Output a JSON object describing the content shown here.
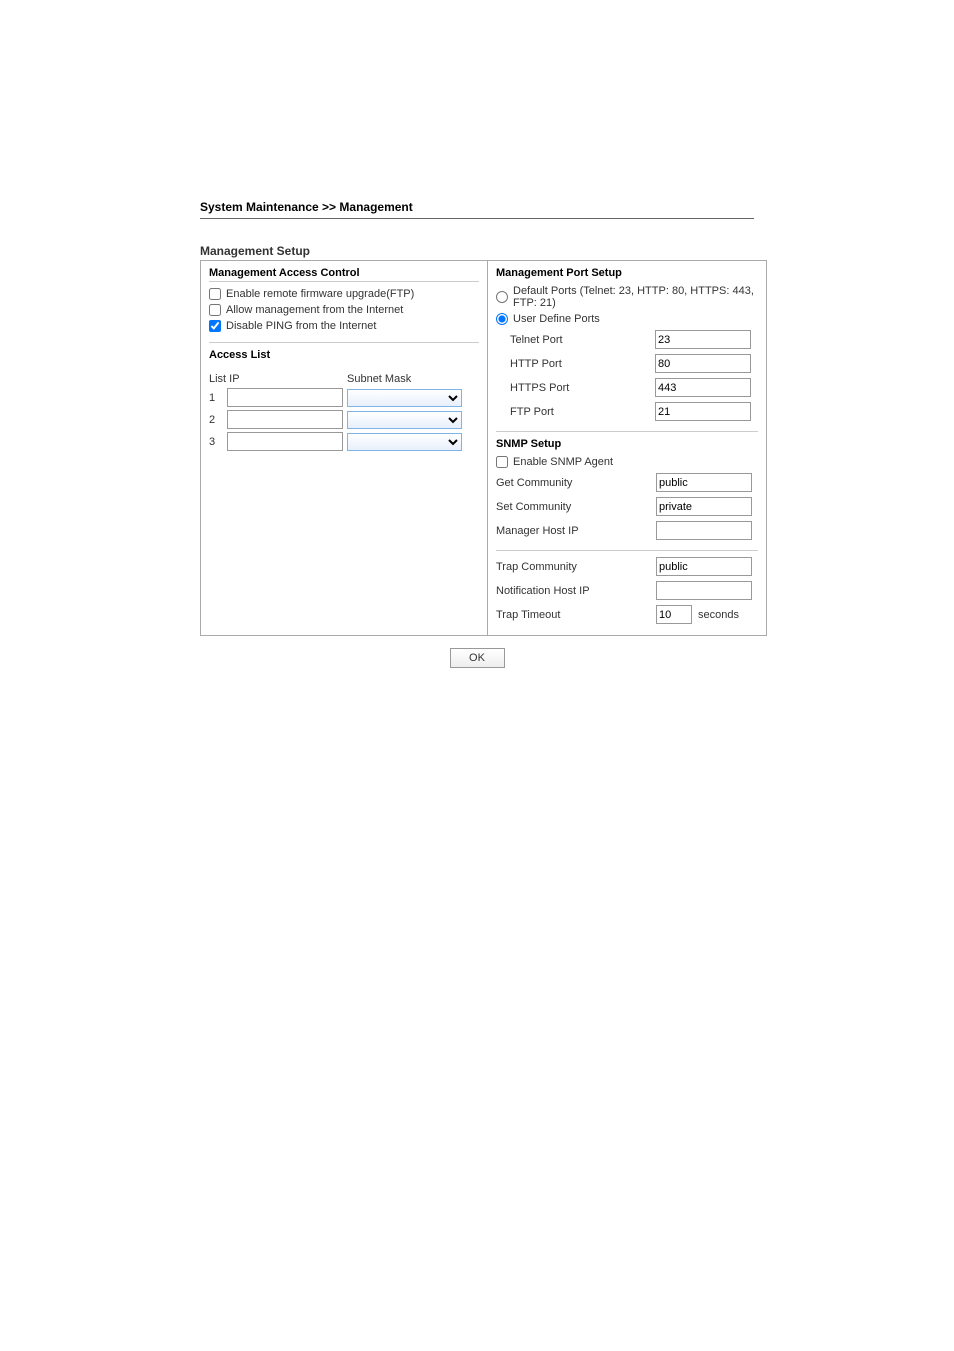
{
  "breadcrumb": "System Maintenance >> Management",
  "setupTitle": "Management Setup",
  "left": {
    "header": "Management Access Control",
    "checkboxes": {
      "enableFirmware": "Enable remote firmware upgrade(FTP)",
      "allowManagement": "Allow management from the Internet",
      "disablePing": "Disable PING from the Internet"
    },
    "accessList": {
      "header": "Access List",
      "listIp": "List IP",
      "subnetMask": "Subnet Mask",
      "rows": [
        "1",
        "2",
        "3"
      ]
    }
  },
  "right": {
    "header": "Management Port Setup",
    "defaultPorts": "Default Ports (Telnet: 23, HTTP: 80, HTTPS: 443, FTP: 21)",
    "userDefine": "User Define Ports",
    "ports": {
      "telnetLabel": "Telnet Port",
      "telnetValue": "23",
      "httpLabel": "HTTP Port",
      "httpValue": "80",
      "httpsLabel": "HTTPS Port",
      "httpsValue": "443",
      "ftpLabel": "FTP Port",
      "ftpValue": "21"
    },
    "snmp": {
      "header": "SNMP Setup",
      "enable": "Enable SNMP Agent",
      "getLabel": "Get Community",
      "getValue": "public",
      "setLabel": "Set Community",
      "setValue": "private",
      "managerLabel": "Manager Host IP",
      "managerValue": "",
      "trapCommLabel": "Trap Community",
      "trapCommValue": "public",
      "notifLabel": "Notification Host IP",
      "notifValue": "",
      "trapTimeoutLabel": "Trap Timeout",
      "trapTimeoutValue": "10",
      "seconds": "seconds"
    }
  },
  "okButton": "OK"
}
